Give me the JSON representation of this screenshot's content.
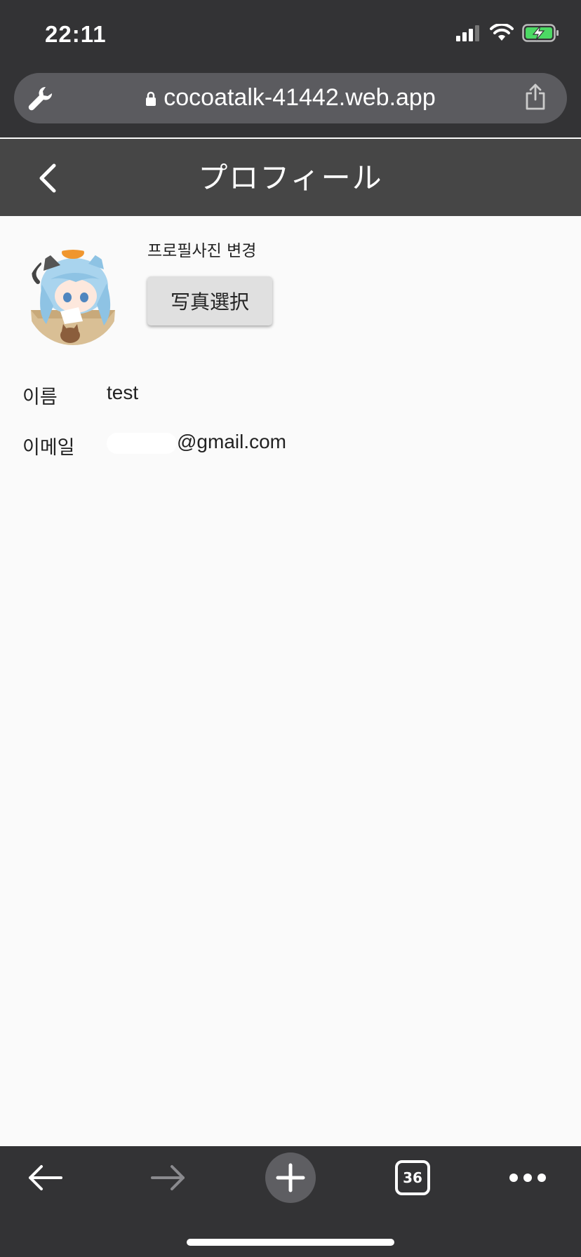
{
  "status_bar": {
    "time": "22:11"
  },
  "browser": {
    "url": "cocoatalk-41442.web.app",
    "icons": {
      "tools": "wrench-icon",
      "secure": "lock-icon",
      "share": "share-icon"
    }
  },
  "header": {
    "title": "プロフィール",
    "back_icon": "chevron-left-icon"
  },
  "profile": {
    "change_photo_label": "프로필사진 변경",
    "select_photo_button": "写真選択",
    "name_label": "이름",
    "name_value": "test",
    "email_label": "이메일",
    "email_value": "@gmail.com"
  },
  "toolbar": {
    "tab_count": "36",
    "items": [
      "back-arrow-icon",
      "forward-arrow-icon",
      "new-tab-icon",
      "tab-switcher-icon",
      "more-icon"
    ]
  },
  "colors": {
    "chrome": "#333335",
    "app_header": "#464646",
    "background": "#fafafa",
    "button": "#e0e0e0",
    "battery": "#4cd964"
  }
}
